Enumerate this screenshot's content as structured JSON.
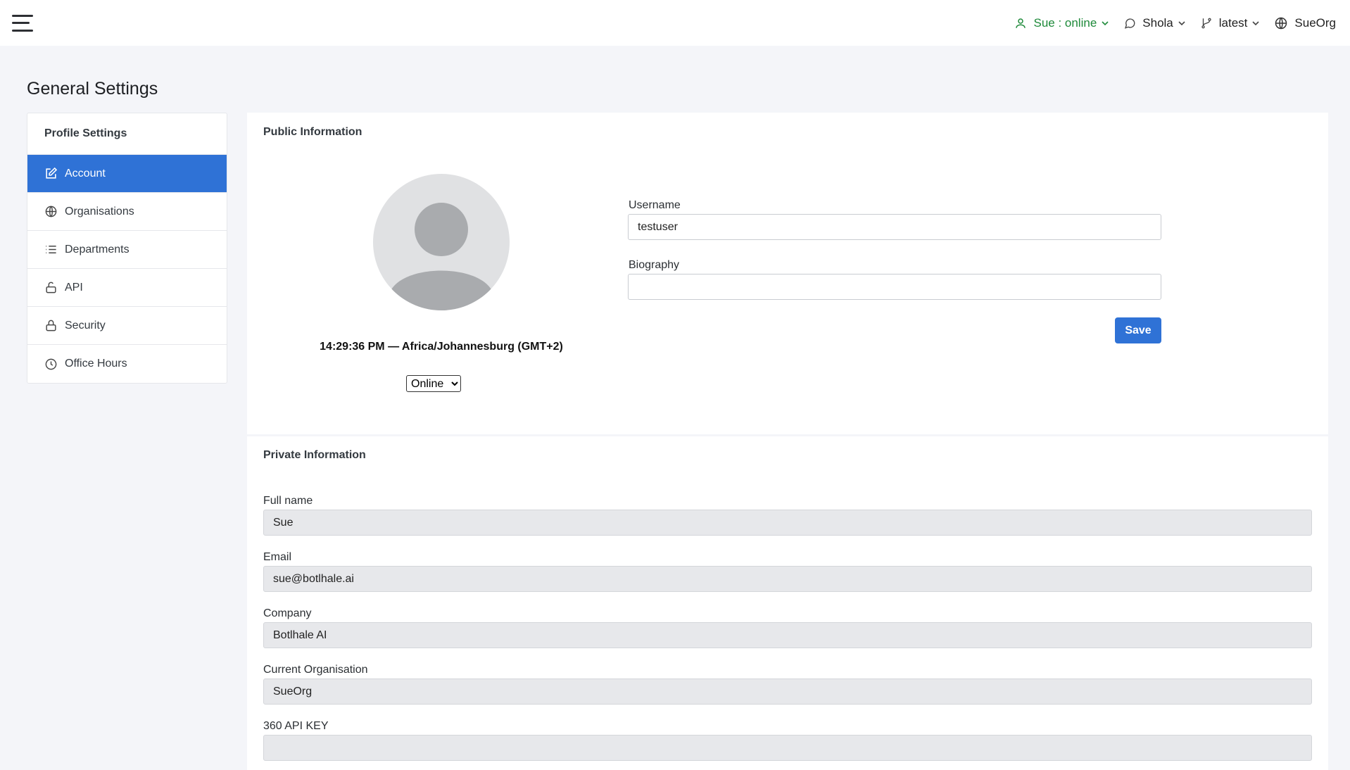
{
  "topbar": {
    "status_label": "Sue : online",
    "chat_user": "Shola",
    "branch": "latest",
    "org": "SueOrg",
    "colors": {
      "status": "#1e8a3a"
    }
  },
  "page": {
    "title": "General Settings"
  },
  "sidebar": {
    "header": "Profile Settings",
    "items": [
      {
        "label": "Account",
        "icon": "edit-icon",
        "active": true
      },
      {
        "label": "Organisations",
        "icon": "globe-icon"
      },
      {
        "label": "Departments",
        "icon": "list-icon"
      },
      {
        "label": "API",
        "icon": "unlock-icon"
      },
      {
        "label": "Security",
        "icon": "lock-icon"
      },
      {
        "label": "Office Hours",
        "icon": "clock-icon"
      }
    ],
    "colors": {
      "active": "#2f72d6"
    }
  },
  "public_info": {
    "title": "Public Information",
    "time_zone_text": "14:29:36 PM — Africa/Johannesburg (GMT+2)",
    "status_option": "Online",
    "username_label": "Username",
    "username_value": "testuser",
    "biography_label": "Biography",
    "biography_value": "",
    "save_label": "Save"
  },
  "private_info": {
    "title": "Private Information",
    "fields": [
      {
        "label": "Full name",
        "value": "Sue"
      },
      {
        "label": "Email",
        "value": "sue@botlhale.ai"
      },
      {
        "label": "Company",
        "value": "Botlhale AI"
      },
      {
        "label": "Current Organisation",
        "value": "SueOrg"
      },
      {
        "label": "360 API KEY",
        "value": ""
      }
    ]
  }
}
